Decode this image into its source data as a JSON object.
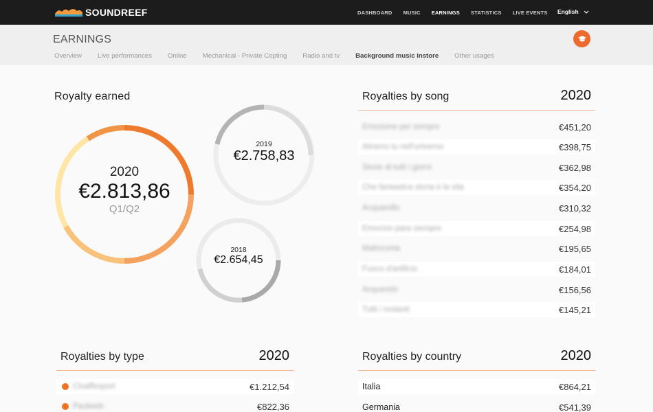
{
  "brand": {
    "name": "SOUNDREEF"
  },
  "nav": {
    "items": [
      {
        "label": "DASHBOARD"
      },
      {
        "label": "MUSIC"
      },
      {
        "label": "EARNINGS"
      },
      {
        "label": "STATISTICS"
      },
      {
        "label": "LIVE EVENTS"
      }
    ],
    "language": "English"
  },
  "header": {
    "title": "EARNINGS",
    "tabs": [
      {
        "label": "Overview"
      },
      {
        "label": "Live performances"
      },
      {
        "label": "Online"
      },
      {
        "label": "Mechanical - Private Copting"
      },
      {
        "label": "Radio and tv"
      },
      {
        "label": "Background music instore"
      },
      {
        "label": "Other usages"
      }
    ],
    "active_tab": "Background music instore"
  },
  "royalty_earned": {
    "title": "Royalty earned",
    "current": {
      "year": "2020",
      "amount": "€2.813,86",
      "period": "Q1/Q2"
    },
    "previous": [
      {
        "year": "2019",
        "amount": "€2.758,83"
      },
      {
        "year": "2018",
        "amount": "€2.654,45"
      }
    ]
  },
  "by_song": {
    "title": "Royalties by song",
    "year": "2020",
    "rows": [
      {
        "name": "Emozione per sempre",
        "value": "€451,20"
      },
      {
        "name": "Almeno tu nell'universo",
        "value": "€398,75"
      },
      {
        "name": "Storie di tutti i giorni",
        "value": "€362,98"
      },
      {
        "name": "Che fantastica storia è la vita",
        "value": "€354,20"
      },
      {
        "name": "Acquarello",
        "value": "€310,32"
      },
      {
        "name": "Emocion para siempre",
        "value": "€254,98"
      },
      {
        "name": "Malinconia",
        "value": "€195,65"
      },
      {
        "name": "Fuoco d'artificio",
        "value": "€184,01"
      },
      {
        "name": "Acquerelo",
        "value": "€156,56"
      },
      {
        "name": "Tutti i restanti",
        "value": "€145,21"
      }
    ]
  },
  "by_type": {
    "title": "Royalties by type",
    "year": "2020",
    "rows": [
      {
        "name": "Cloaffesport",
        "value": "€1.212,54"
      },
      {
        "name": "Packeeb",
        "value": "€822,36"
      }
    ]
  },
  "by_country": {
    "title": "Royalties by country",
    "year": "2020",
    "rows": [
      {
        "name": "Italia",
        "value": "€864,21"
      },
      {
        "name": "Germania",
        "value": "€541,39"
      }
    ]
  },
  "colors": {
    "accent": "#ec6a2c",
    "topbar": "#1c1c1c",
    "divider": "#f2b594"
  }
}
